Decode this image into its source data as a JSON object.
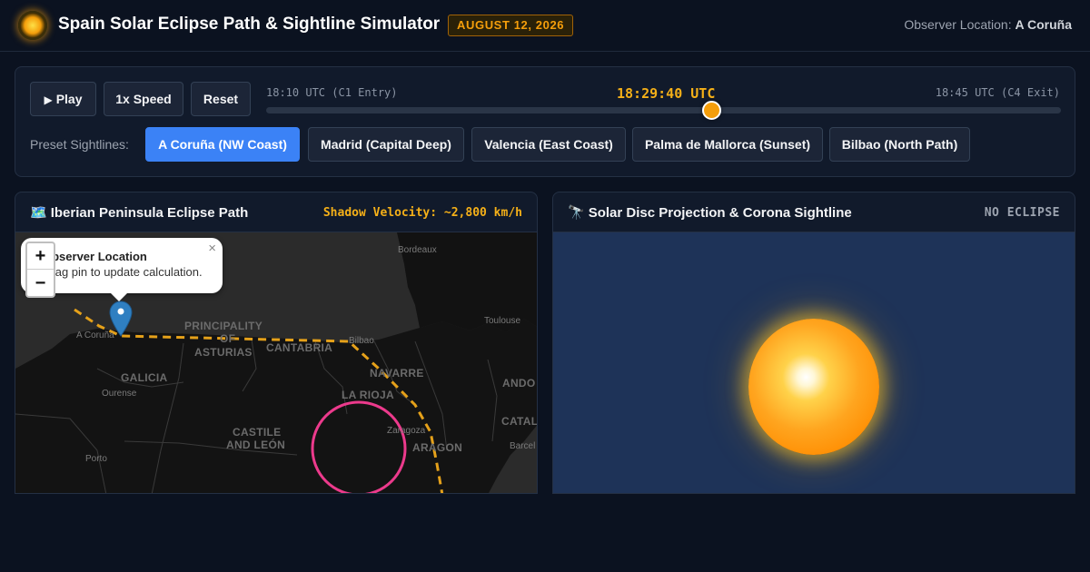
{
  "header": {
    "title": "Spain Solar Eclipse Path & Sightline Simulator",
    "date_badge": "AUGUST 12, 2026",
    "observer_label": "Observer Location:",
    "observer_value": "A Coruña"
  },
  "controls": {
    "play_label": "Play",
    "play_icon": "▶",
    "speed_label": "1x Speed",
    "reset_label": "Reset",
    "timeline": {
      "start_label": "18:10 UTC (C1 Entry)",
      "end_label": "18:45 UTC (C4 Exit)",
      "current_time": "18:29:40 UTC",
      "progress": 0.56
    },
    "preset_label": "Preset Sightlines:",
    "presets": [
      {
        "label": "A Coruña (NW Coast)",
        "active": true
      },
      {
        "label": "Madrid (Capital Deep)",
        "active": false
      },
      {
        "label": "Valencia (East Coast)",
        "active": false
      },
      {
        "label": "Palma de Mallorca (Sunset)",
        "active": false
      },
      {
        "label": "Bilbao (North Path)",
        "active": false
      }
    ]
  },
  "map_panel": {
    "icon": "🗺️",
    "title": "Iberian Peninsula Eclipse Path",
    "velocity": "Shadow Velocity: ~2,800 km/h",
    "zoom_in": "+",
    "zoom_out": "−",
    "popup": {
      "title": "Observer Location",
      "text": "Drag pin to update calculation.",
      "close": "×"
    },
    "regions": [
      "PRINCIPALITY",
      "OF",
      "ASTURIAS",
      "CANTABRIA",
      "GALICIA",
      "NAVARRE",
      "LA RIOJA",
      "CASTILE",
      "AND LEÓN",
      "ARAGON",
      "ANDO",
      "CATAL"
    ],
    "cities": [
      "Bordeaux",
      "Toulouse",
      "A Coruña",
      "Bilbao",
      "Ourense",
      "Zaragoza",
      "Porto",
      "Barcel"
    ],
    "path_color": "#e5a11a",
    "umbra_color": "#ec3a8c"
  },
  "sun_panel": {
    "icon": "🔭",
    "title": "Solar Disc Projection & Corona Sightline",
    "status": "NO ECLIPSE"
  }
}
